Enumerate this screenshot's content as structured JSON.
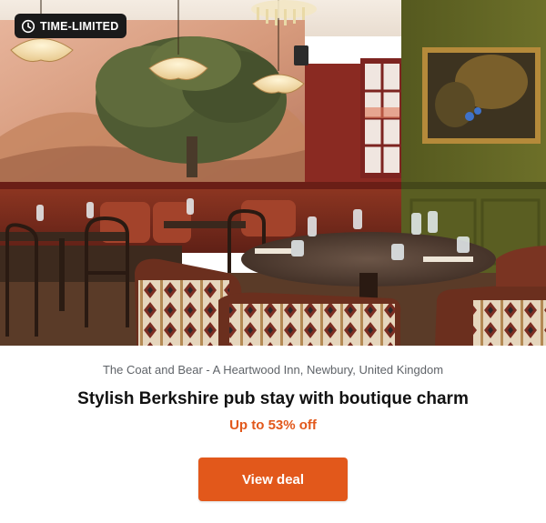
{
  "colors": {
    "accent": "#e2581b",
    "badge_bg": "#1a1a1a",
    "discount_text": "#e2581b",
    "location_text": "#5f6368",
    "title_text": "#111111"
  },
  "deal": {
    "badge": {
      "label": "TIME-LIMITED",
      "icon": "clock-icon"
    },
    "image": {
      "subject": "pub-restaurant-interior"
    },
    "location": "The Coat and Bear - A Heartwood Inn, Newbury, United Kingdom",
    "title": "Stylish Berkshire pub stay with boutique charm",
    "discount": "Up to 53% off",
    "cta_label": "View deal"
  }
}
